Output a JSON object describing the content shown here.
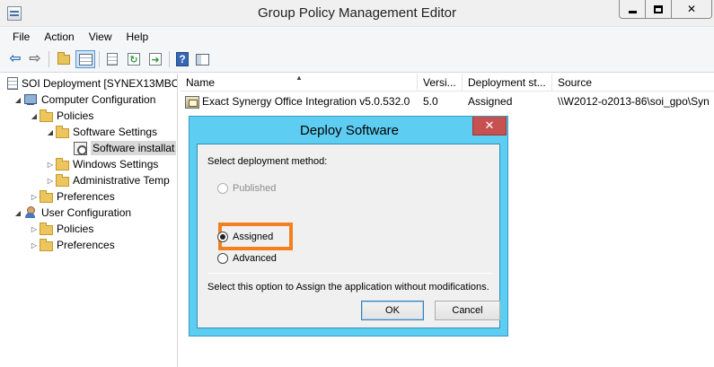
{
  "window": {
    "title": "Group Policy Management Editor",
    "minimize_icon": "minimize-icon",
    "maximize_icon": "maximize-icon",
    "close_glyph": "✕"
  },
  "menu": [
    "File",
    "Action",
    "View",
    "Help"
  ],
  "toolbar": {
    "icons": [
      "back-arrow-icon",
      "forward-arrow-icon",
      "up-folder-icon",
      "show-hide-tree-icon",
      "properties-icon",
      "refresh-icon",
      "export-list-icon",
      "help-icon",
      "show-action-pane-icon"
    ],
    "back_glyph": "⇦",
    "forward_glyph": "⇨",
    "help_glyph": "?",
    "refresh_glyph": "↻",
    "export_glyph": "➜"
  },
  "tree": {
    "root": "SOI Deployment [SYNEX13MBO",
    "computer_config": "Computer Configuration",
    "policies": "Policies",
    "software_settings": "Software Settings",
    "software_installation": "Software installat",
    "windows_settings": "Windows Settings",
    "admin_templates": "Administrative Temp",
    "preferences": "Preferences",
    "user_config": "User Configuration",
    "user_policies": "Policies",
    "user_preferences": "Preferences",
    "glyph_expanded": "◢",
    "glyph_collapsed": "▷"
  },
  "list": {
    "columns": [
      "Name",
      "Versi...",
      "Deployment st...",
      "Source"
    ],
    "sort_glyph": "▲",
    "rows": [
      {
        "name": "Exact Synergy Office Integration v5.0.532.0",
        "version": "5.0",
        "deployment": "Assigned",
        "source": "\\\\W2012-o2013-86\\soi_gpo\\Syn"
      }
    ]
  },
  "dialog": {
    "title": "Deploy Software",
    "close_glyph": "✕",
    "prompt": "Select deployment method:",
    "options": [
      {
        "label": "Published",
        "checked": false,
        "disabled": true
      },
      {
        "label": "Assigned",
        "checked": true,
        "disabled": false
      },
      {
        "label": "Advanced",
        "checked": false,
        "disabled": false
      }
    ],
    "description": "Select this option to Assign the application without modifications.",
    "ok_label": "OK",
    "cancel_label": "Cancel",
    "highlight_color": "#f3801f"
  },
  "colors": {
    "dialog_frame": "#5ecdf2",
    "dialog_close": "#c75050",
    "selection": "#cde4f7"
  }
}
